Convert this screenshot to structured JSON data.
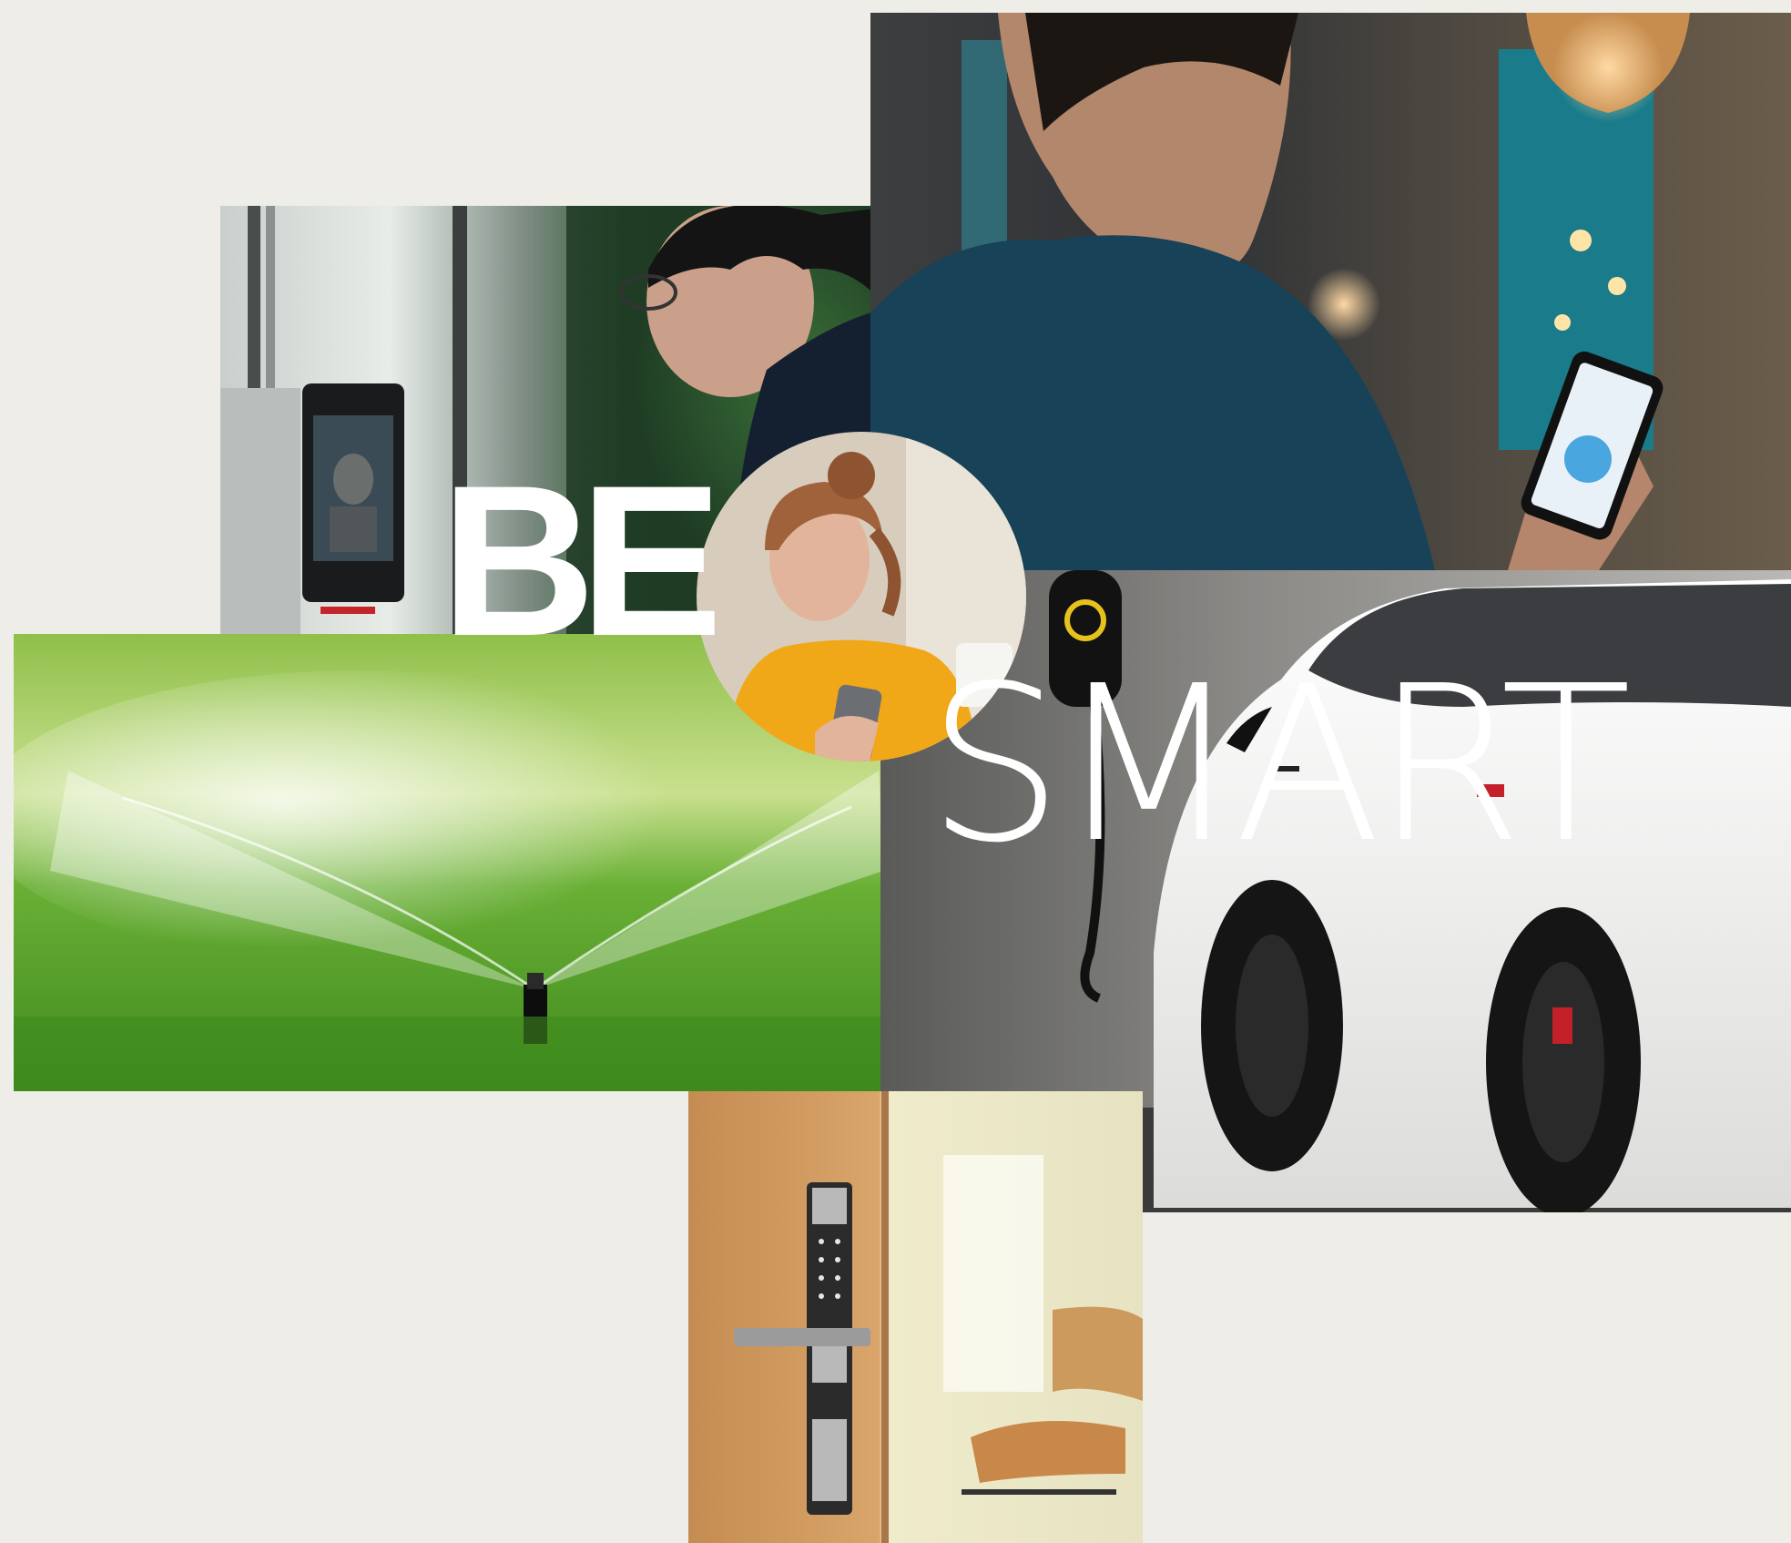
{
  "hero": {
    "word_bold": "BE",
    "word_light": "SMART"
  },
  "tiles": [
    {
      "name": "face-recognition-photo",
      "subject": "face-recognition-icon"
    },
    {
      "name": "smartphone-control-photo",
      "subject": "smartphone-icon"
    },
    {
      "name": "lawn-sprinkler-photo",
      "subject": "sprinkler-icon"
    },
    {
      "name": "ev-charging-photo",
      "subject": "ev-charger-icon"
    },
    {
      "name": "smart-door-lock-photo",
      "subject": "keypad-lock-icon"
    },
    {
      "name": "woman-with-phone-photo",
      "subject": "person-icon"
    }
  ],
  "colors": {
    "background": "#eeede8",
    "headline": "#ffffff",
    "grass": "#5fae2f",
    "car_white": "#f4f4f2",
    "sweater": "#f0a818"
  }
}
